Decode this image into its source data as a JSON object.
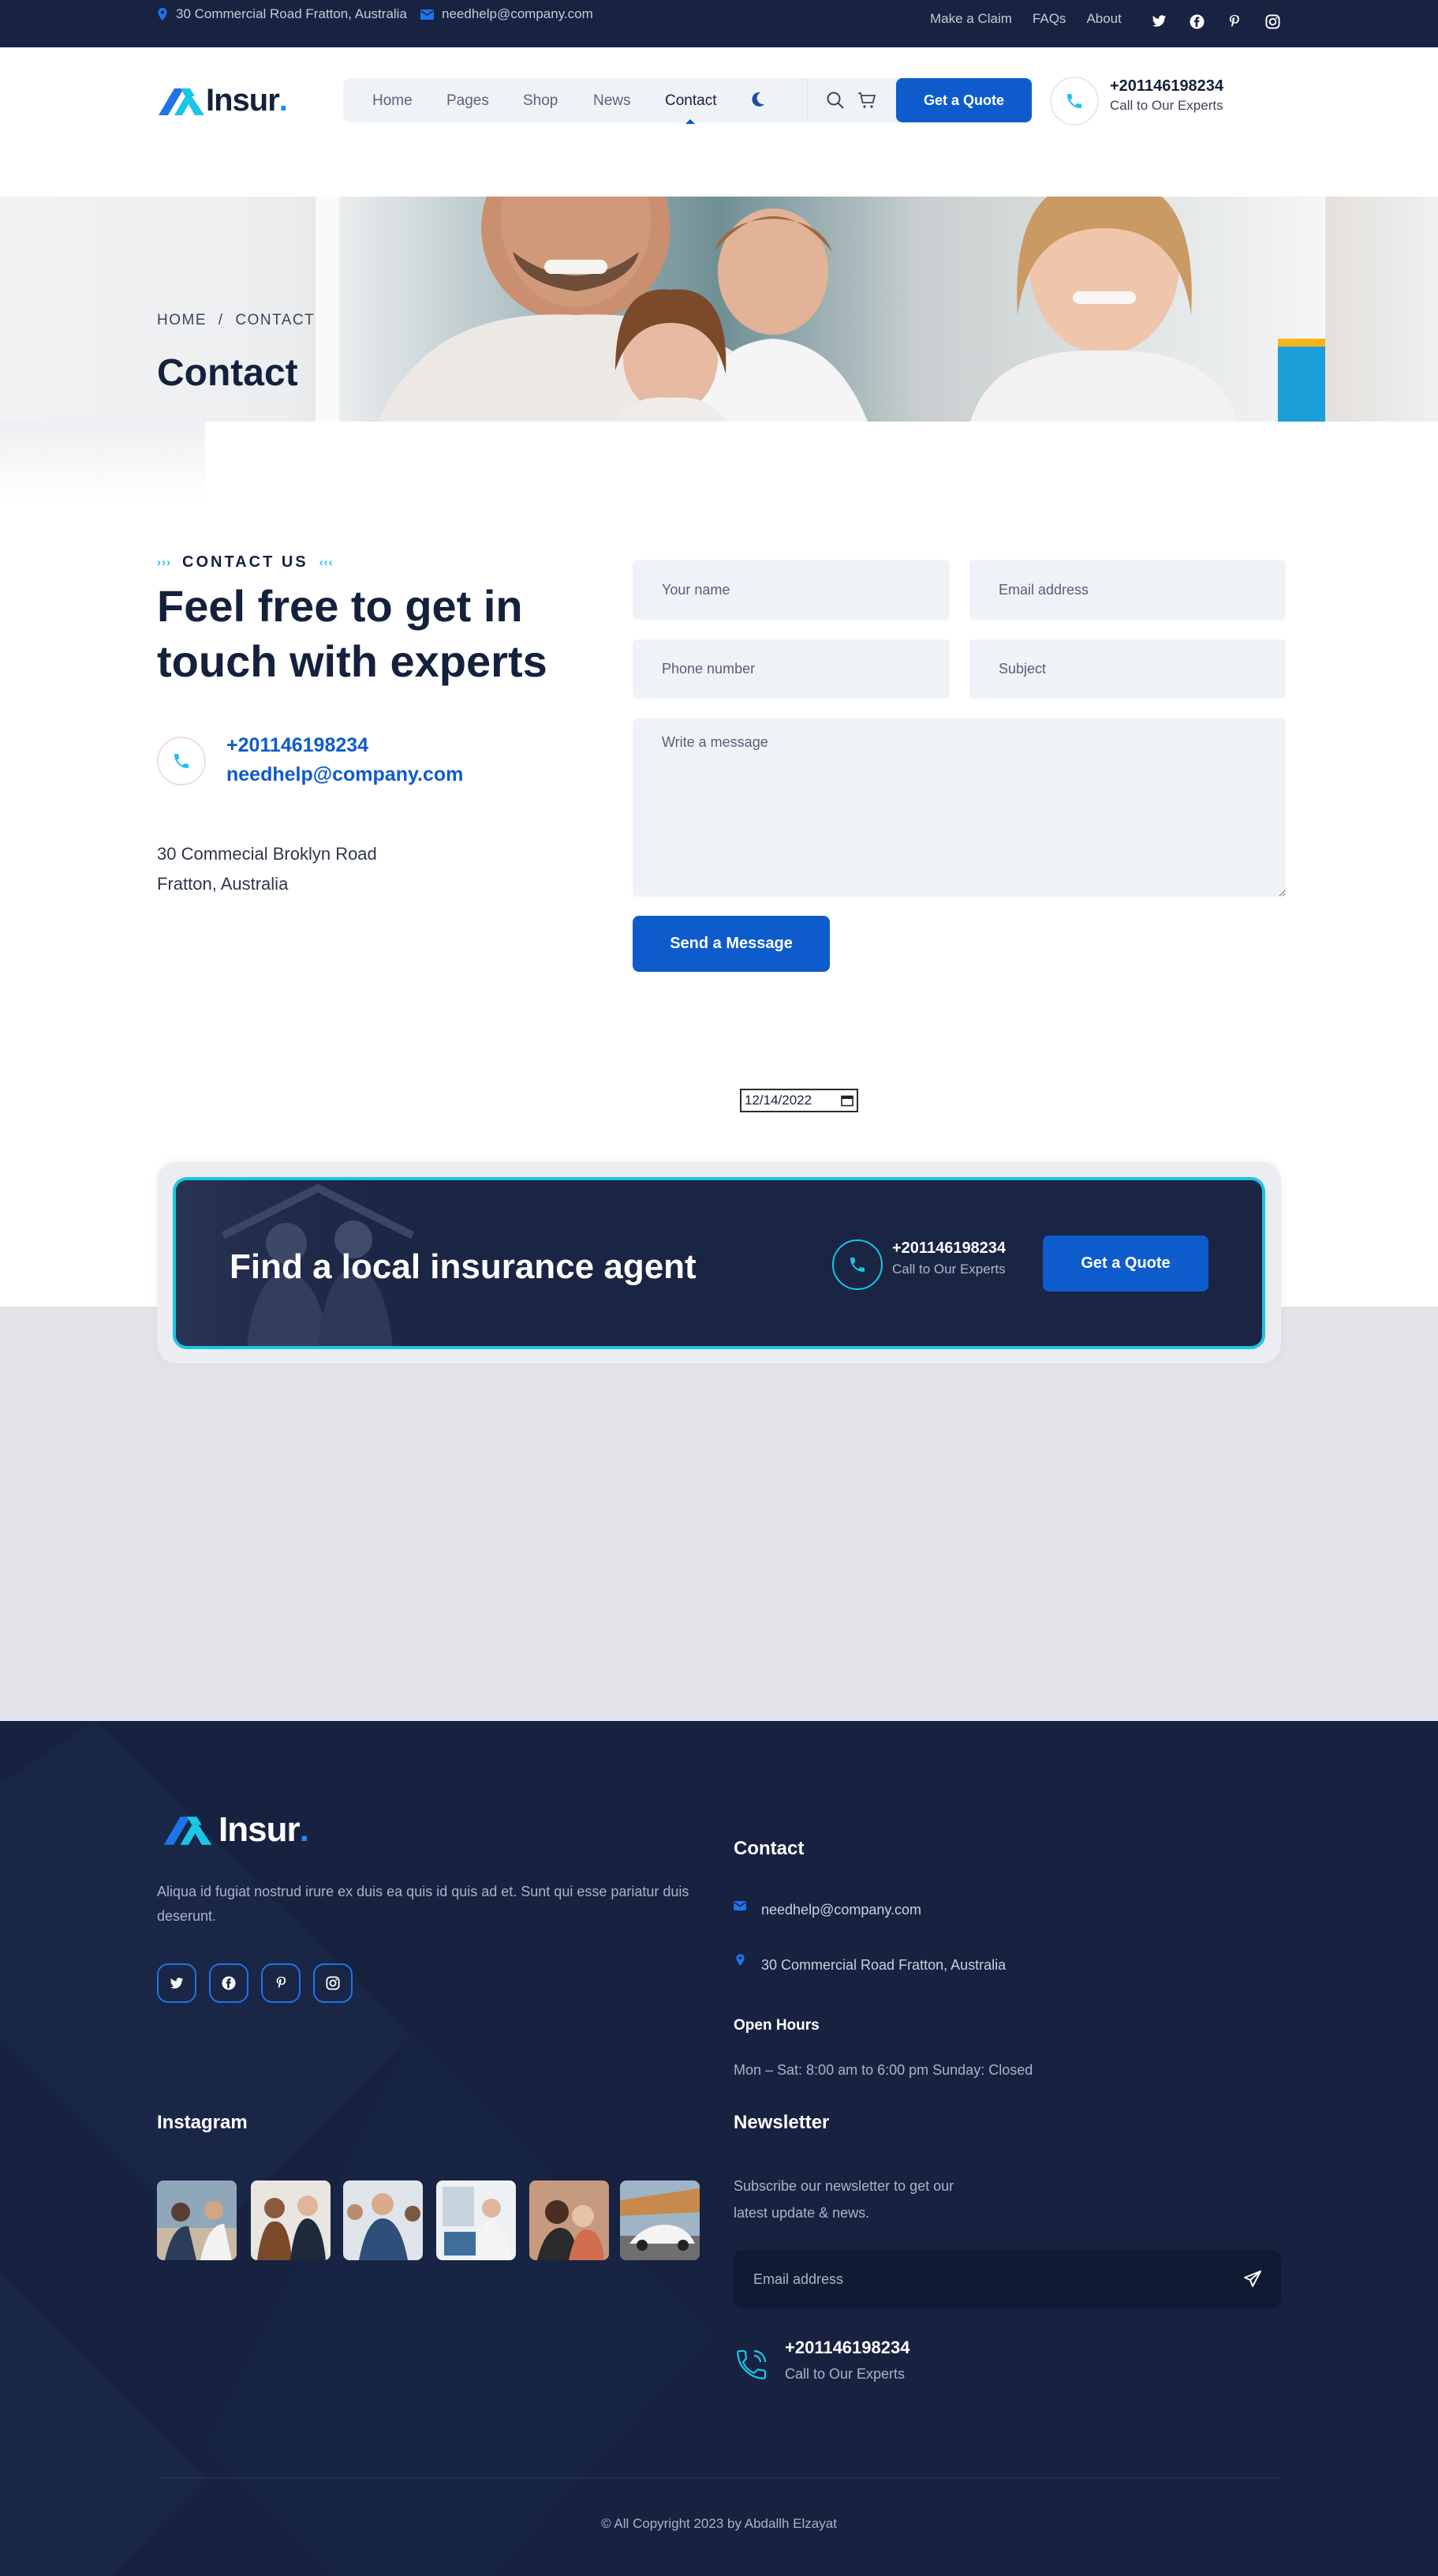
{
  "topbar": {
    "address": "30 Commercial Road Fratton, Australia",
    "email": "needhelp@company.com",
    "links": [
      "Make a Claim",
      "FAQs",
      "About"
    ]
  },
  "brand": {
    "name": "Insur",
    "dot": "."
  },
  "nav": {
    "items": [
      "Home",
      "Pages",
      "Shop",
      "News",
      "Contact"
    ],
    "active": "Contact",
    "quote_label": "Get a Quote"
  },
  "header_contact": {
    "phone": "+201146198234",
    "caption": "Call to Our Experts"
  },
  "hero": {
    "breadcrumb_home": "HOME",
    "breadcrumb_sep": "/",
    "breadcrumb_current": "CONTACT",
    "title": "Contact"
  },
  "contact": {
    "eyebrow": "CONTACT US",
    "heading": "Feel free to get in touch with experts",
    "phone": "+201146198234",
    "email": "needhelp@company.com",
    "address_line1": "30 Commecial Broklyn Road",
    "address_line2": "Fratton, Australia"
  },
  "form": {
    "name_placeholder": "Your name",
    "email_placeholder": "Email address",
    "phone_placeholder": "Phone number",
    "subject_placeholder": "Subject",
    "message_placeholder": "Write a message",
    "submit_label": "Send a Message",
    "date_value": "12/14/2022"
  },
  "cta": {
    "title": "Find a local insurance agent",
    "phone": "+201146198234",
    "caption": "Call to Our Experts",
    "button": "Get a Quote"
  },
  "footer": {
    "about": "Aliqua id fugiat nostrud irure ex duis ea quis id quis ad et. Sunt qui esse pariatur duis deserunt.",
    "contact_heading": "Contact",
    "email": "needhelp@company.com",
    "address": "30 Commercial Road Fratton, Australia",
    "hours_heading": "Open Hours",
    "hours": "Mon – Sat: 8:00 am to 6:00 pm Sunday: Closed",
    "instagram_heading": "Instagram",
    "newsletter_heading": "Newsletter",
    "newsletter_text_1": "Subscribe our newsletter to get our",
    "newsletter_text_2": "latest update & news.",
    "newsletter_placeholder": "Email address",
    "phone": "+201146198234",
    "phone_caption": "Call to Our Experts",
    "copyright": "© All Copyright 2023 by Abdallh Elzayat"
  },
  "colors": {
    "navy": "#172340",
    "primary": "#0e5bcc",
    "accent": "#19c6e6",
    "footer_bg": "#162240"
  }
}
